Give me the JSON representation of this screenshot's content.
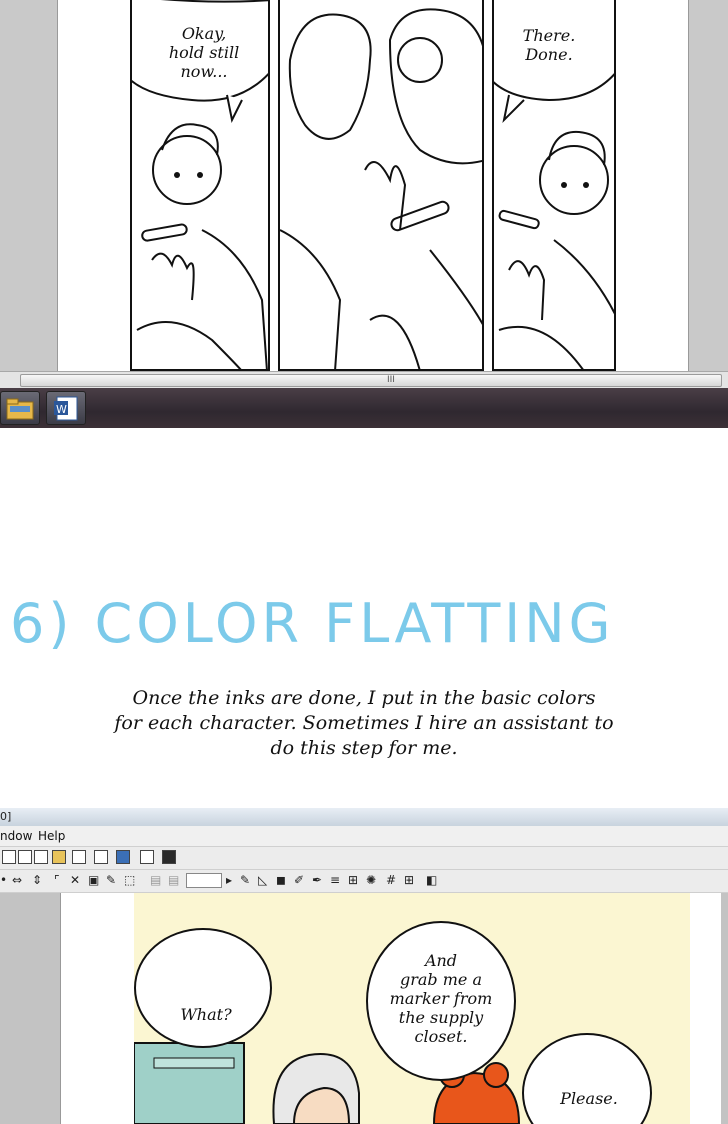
{
  "top_screenshot": {
    "panel1_speech": [
      "Okay,",
      "hold still",
      "now..."
    ],
    "panel3_speech": [
      "There.",
      "Done."
    ],
    "scrollbar_grip": "III"
  },
  "section": {
    "heading": "6) COLOR FLATTING",
    "body_lines": [
      "Once the inks are done, I put in the basic colors",
      "for each character. Sometimes I hire an assistant to",
      "do this step for me."
    ]
  },
  "bottom_screenshot": {
    "title_fragment": "0]",
    "menu": [
      "ndow",
      "Help"
    ],
    "speech_what": "What?",
    "speech_marker": [
      "And",
      "grab me a",
      "marker from",
      "the supply",
      "closet."
    ],
    "speech_please": "Please."
  },
  "colors": {
    "heading": "#7ccaea",
    "page_flat": "#fbf6d2",
    "hair_orange": "#e8561b",
    "fridge_teal": "#9fd0c8",
    "character_skin": "#f7dcc2"
  }
}
